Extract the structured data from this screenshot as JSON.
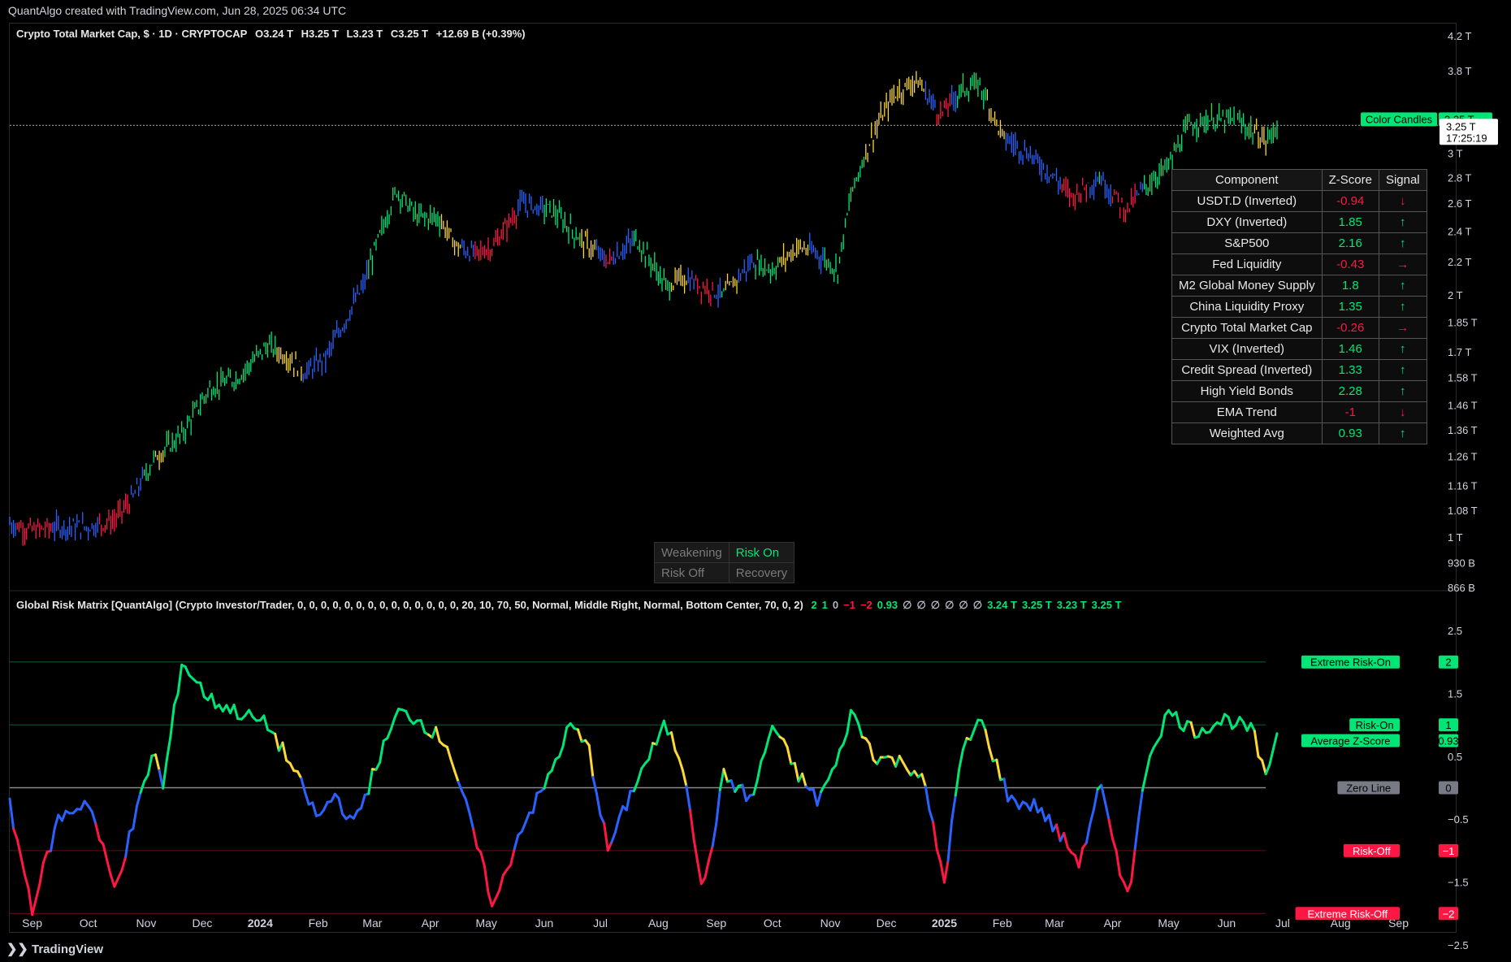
{
  "header": {
    "credit": "QuantAlgo created with TradingView.com, Jun 28, 2025 06:34 UTC"
  },
  "main_legend": {
    "symbol": "Crypto Total Market Cap, $ · 1D · CRYPTOCAP",
    "open": "O3.24 T",
    "high": "H3.25 T",
    "low": "L3.23 T",
    "close": "C3.25 T",
    "change": "+12.69 B (+0.39%)"
  },
  "indicator_legend": {
    "name": "Global Risk Matrix [QuantAlgo] (Crypto Investor/Trader, 0, 0, 0, 0, 0, 0, 0, 0, 0, 0, 0, 0, 0, 0, 20, 10, 70, 50, Normal, Middle Right, Normal, Bottom Center, 70, 0, 2)",
    "values": [
      {
        "text": "2",
        "color": "#00e676"
      },
      {
        "text": "1",
        "color": "#00e676"
      },
      {
        "text": "0",
        "color": "#b2b5be"
      },
      {
        "text": "−1",
        "color": "#ff1744"
      },
      {
        "text": "−2",
        "color": "#ff1744"
      },
      {
        "text": "0.93",
        "color": "#00e676"
      },
      {
        "text": "∅",
        "color": "#b2b5be"
      },
      {
        "text": "∅",
        "color": "#b2b5be"
      },
      {
        "text": "∅",
        "color": "#b2b5be"
      },
      {
        "text": "∅",
        "color": "#b2b5be"
      },
      {
        "text": "∅",
        "color": "#b2b5be"
      },
      {
        "text": "∅",
        "color": "#b2b5be"
      },
      {
        "text": "3.24 T",
        "color": "#00e676"
      },
      {
        "text": "3.25 T",
        "color": "#00e676"
      },
      {
        "text": "3.23 T",
        "color": "#00e676"
      },
      {
        "text": "3.25 T",
        "color": "#00e676"
      }
    ]
  },
  "price_axis": [
    "4.2 T",
    "3.8 T",
    "3 T",
    "2.8 T",
    "2.6 T",
    "2.4 T",
    "2.2 T",
    "2 T",
    "1.85 T",
    "1.7 T",
    "1.58 T",
    "1.46 T",
    "1.36 T",
    "1.26 T",
    "1.16 T",
    "1.08 T",
    "1 T",
    "930 B",
    "866 B"
  ],
  "price_tags": {
    "color_candles_label": "Color Candles",
    "color_candles_value": "3.25 T",
    "last_price": "3.25 T",
    "countdown": "17:25:19"
  },
  "indicator_axis": [
    "2.5",
    "1.5",
    "0.5",
    "−0.5",
    "−1.5",
    "−2.5"
  ],
  "indicator_tags": [
    {
      "label": "Extreme Risk-On",
      "value": "2",
      "bg": "#00e676",
      "fg": "#000"
    },
    {
      "label": "Risk-On",
      "value": "1",
      "bg": "#00e676",
      "fg": "#000"
    },
    {
      "label": "Average Z-Score",
      "value": "0.93",
      "bg": "#00e676",
      "fg": "#000"
    },
    {
      "label": "Zero Line",
      "value": "0",
      "bg": "#787b86",
      "fg": "#000"
    },
    {
      "label": "Risk-Off",
      "value": "−1",
      "bg": "#ff1744",
      "fg": "#fff"
    },
    {
      "label": "Extreme Risk-Off",
      "value": "−2",
      "bg": "#ff1744",
      "fg": "#fff"
    }
  ],
  "time_axis": [
    "Sep",
    "Oct",
    "Nov",
    "Dec",
    "2024",
    "Feb",
    "Mar",
    "Apr",
    "May",
    "Jun",
    "Jul",
    "Aug",
    "Sep",
    "Oct",
    "Nov",
    "Dec",
    "2025",
    "Feb",
    "Mar",
    "Apr",
    "May",
    "Jun",
    "Jul",
    "Aug",
    "Sep"
  ],
  "table": {
    "headers": [
      "Component",
      "Z-Score",
      "Signal"
    ],
    "rows": [
      {
        "component": "USDT.D (Inverted)",
        "z": "-0.94",
        "signal": "↓",
        "color": "#ff1744"
      },
      {
        "component": "DXY (Inverted)",
        "z": "1.85",
        "signal": "↑",
        "color": "#00e676"
      },
      {
        "component": "S&P500",
        "z": "2.16",
        "signal": "↑",
        "color": "#00e676"
      },
      {
        "component": "Fed Liquidity",
        "z": "-0.43",
        "signal": "→",
        "color": "#ff1744"
      },
      {
        "component": "M2 Global Money Supply",
        "z": "1.8",
        "signal": "↑",
        "color": "#00e676"
      },
      {
        "component": "China Liquidity Proxy",
        "z": "1.35",
        "signal": "↑",
        "color": "#00e676"
      },
      {
        "component": "Crypto Total Market Cap",
        "z": "-0.26",
        "signal": "→",
        "color": "#ff1744"
      },
      {
        "component": "VIX (Inverted)",
        "z": "1.46",
        "signal": "↑",
        "color": "#00e676"
      },
      {
        "component": "Credit Spread (Inverted)",
        "z": "1.33",
        "signal": "↑",
        "color": "#00e676"
      },
      {
        "component": "High Yield Bonds",
        "z": "2.28",
        "signal": "↑",
        "color": "#00e676"
      },
      {
        "component": "EMA Trend",
        "z": "-1",
        "signal": "↓",
        "color": "#ff1744"
      },
      {
        "component": "Weighted Avg",
        "z": "0.93",
        "signal": "↑",
        "color": "#00e676"
      }
    ]
  },
  "state_grid": {
    "weakening": "Weakening",
    "risk_on": "Risk On",
    "risk_off": "Risk Off",
    "recovery": "Recovery",
    "active_color": "#00e676"
  },
  "footer": {
    "brand": "TradingView"
  },
  "colors": {
    "risk_on": "#00e676",
    "weakening": "#fdd835",
    "recovery": "#2962ff",
    "risk_off": "#ff1744"
  },
  "chart_data": [
    {
      "type": "line",
      "subtype": "candlestick-close",
      "title": "Crypto Total Market Cap, $ · 1D · CRYPTOCAP",
      "x": [
        "2023-08-20",
        "2023-09-01",
        "2023-09-15",
        "2023-10-01",
        "2023-10-15",
        "2023-10-25",
        "2023-11-05",
        "2023-11-20",
        "2023-12-05",
        "2023-12-20",
        "2024-01-05",
        "2024-01-15",
        "2024-01-25",
        "2024-02-05",
        "2024-02-15",
        "2024-02-25",
        "2024-03-05",
        "2024-03-14",
        "2024-03-25",
        "2024-04-05",
        "2024-04-15",
        "2024-04-25",
        "2024-05-05",
        "2024-05-20",
        "2024-06-05",
        "2024-06-20",
        "2024-07-05",
        "2024-07-20",
        "2024-08-05",
        "2024-08-15",
        "2024-08-25",
        "2024-09-05",
        "2024-09-20",
        "2024-10-01",
        "2024-10-15",
        "2024-10-25",
        "2024-11-05",
        "2024-11-12",
        "2024-11-22",
        "2024-12-05",
        "2024-12-17",
        "2024-12-30",
        "2025-01-10",
        "2025-01-20",
        "2025-02-01",
        "2025-02-15",
        "2025-03-01",
        "2025-03-10",
        "2025-03-25",
        "2025-04-08",
        "2025-04-20",
        "2025-05-01",
        "2025-05-12",
        "2025-05-22",
        "2025-06-05",
        "2025-06-15",
        "2025-06-22",
        "2025-06-28"
      ],
      "values": [
        1.04,
        1.02,
        1.03,
        1.03,
        1.05,
        1.12,
        1.25,
        1.34,
        1.53,
        1.58,
        1.73,
        1.68,
        1.6,
        1.67,
        1.85,
        2.05,
        2.37,
        2.7,
        2.5,
        2.5,
        2.3,
        2.25,
        2.3,
        2.6,
        2.55,
        2.35,
        2.2,
        2.35,
        2.05,
        2.1,
        2.05,
        2.0,
        2.2,
        2.15,
        2.3,
        2.25,
        2.15,
        2.65,
        3.1,
        3.55,
        3.7,
        3.35,
        3.6,
        3.65,
        3.15,
        3.0,
        2.8,
        2.65,
        2.8,
        2.55,
        2.75,
        2.9,
        3.25,
        3.3,
        3.3,
        3.2,
        3.1,
        3.25
      ],
      "y_scale": "log",
      "ylim": [
        "866 B",
        "4.2 T"
      ]
    },
    {
      "type": "line",
      "title": "Global Risk Matrix [QuantAlgo]",
      "x": [
        "2023-08-20",
        "2023-09-01",
        "2023-09-15",
        "2023-10-01",
        "2023-10-15",
        "2023-10-25",
        "2023-11-05",
        "2023-11-10",
        "2023-11-20",
        "2023-12-05",
        "2023-12-20",
        "2024-01-05",
        "2024-01-15",
        "2024-02-01",
        "2024-02-10",
        "2024-02-20",
        "2024-03-05",
        "2024-03-15",
        "2024-03-25",
        "2024-04-10",
        "2024-04-22",
        "2024-05-05",
        "2024-05-20",
        "2024-06-01",
        "2024-06-15",
        "2024-06-25",
        "2024-07-05",
        "2024-07-20",
        "2024-08-05",
        "2024-08-15",
        "2024-08-25",
        "2024-09-05",
        "2024-09-20",
        "2024-10-01",
        "2024-10-15",
        "2024-10-25",
        "2024-11-05",
        "2024-11-12",
        "2024-11-25",
        "2024-12-10",
        "2024-12-20",
        "2025-01-01",
        "2025-01-10",
        "2025-01-20",
        "2025-02-05",
        "2025-02-20",
        "2025-03-05",
        "2025-03-15",
        "2025-03-25",
        "2025-04-05",
        "2025-04-10",
        "2025-04-20",
        "2025-05-01",
        "2025-05-15",
        "2025-06-01",
        "2025-06-15",
        "2025-06-22",
        "2025-06-28"
      ],
      "values": [
        -0.3,
        -1.9,
        -0.5,
        -0.2,
        -1.6,
        -0.6,
        0.6,
        0.0,
        2.0,
        1.4,
        1.2,
        1.0,
        0.5,
        -0.5,
        -0.1,
        -0.6,
        0.5,
        1.2,
        1.1,
        0.7,
        -0.5,
        -1.9,
        -0.6,
        0.0,
        1.0,
        0.6,
        -1.0,
        0.1,
        1.0,
        0.3,
        -1.7,
        0.2,
        -0.2,
        1.0,
        0.2,
        -0.2,
        0.4,
        1.2,
        0.5,
        0.4,
        0.2,
        -1.5,
        0.5,
        1.1,
        -0.2,
        -0.3,
        -0.8,
        -1.2,
        0.1,
        -1.4,
        -1.6,
        0.5,
        1.2,
        0.9,
        1.1,
        0.9,
        0.1,
        0.93
      ],
      "ylim": [
        -2.5,
        2.5
      ],
      "reference_lines": [
        2,
        1,
        0,
        -1,
        -2
      ]
    }
  ]
}
